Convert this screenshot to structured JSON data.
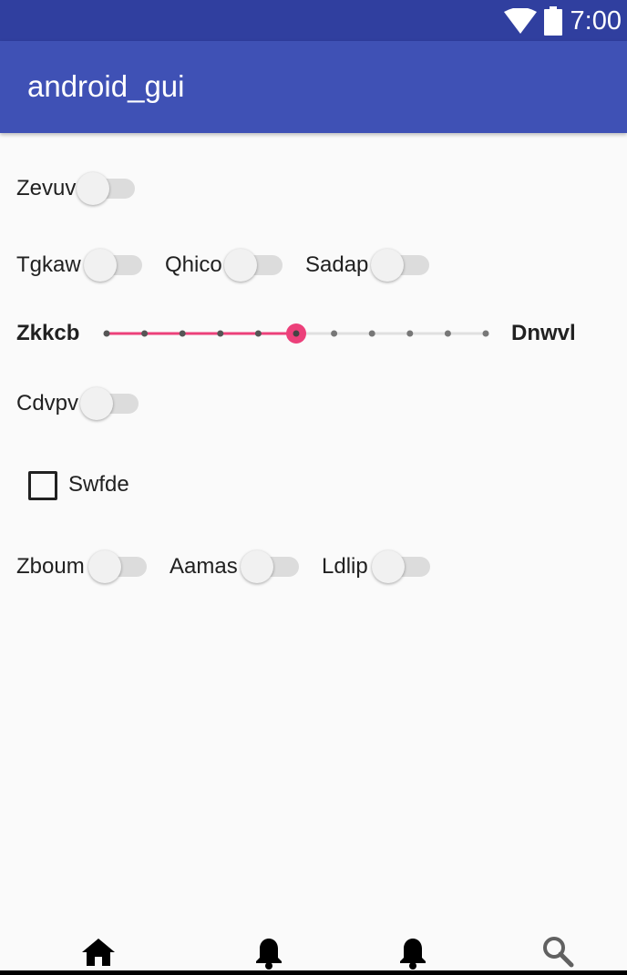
{
  "status_bar": {
    "time": "7:00",
    "icons": [
      "wifi-icon",
      "battery-icon"
    ]
  },
  "app_bar": {
    "title": "android_gui"
  },
  "rows": {
    "row1": {
      "switch_label": "Zevuv",
      "checked": false
    },
    "row2": [
      {
        "switch_label": "Tgkaw",
        "checked": false
      },
      {
        "switch_label": "Qhico",
        "checked": false
      },
      {
        "switch_label": "Sadap",
        "checked": false
      }
    ],
    "slider": {
      "min_label": "Zkkcb",
      "max_label": "Dnwvl",
      "steps": 10,
      "value": 5,
      "accent": "#ec407a"
    },
    "row4": {
      "switch_label": "Cdvpv",
      "checked": false
    },
    "checkbox": {
      "label": "Swfde",
      "checked": false
    },
    "row6": [
      {
        "switch_label": "Zboum",
        "checked": false
      },
      {
        "switch_label": "Aamas",
        "checked": false
      },
      {
        "switch_label": "Ldlip",
        "checked": false
      }
    ]
  },
  "bottom_nav": {
    "items": [
      "home-icon",
      "bell-icon",
      "bell-icon",
      "search-icon"
    ]
  },
  "colors": {
    "status_bar": "#303f9f",
    "app_bar": "#3f51b5",
    "accent": "#ec407a",
    "background": "#fafafa"
  }
}
